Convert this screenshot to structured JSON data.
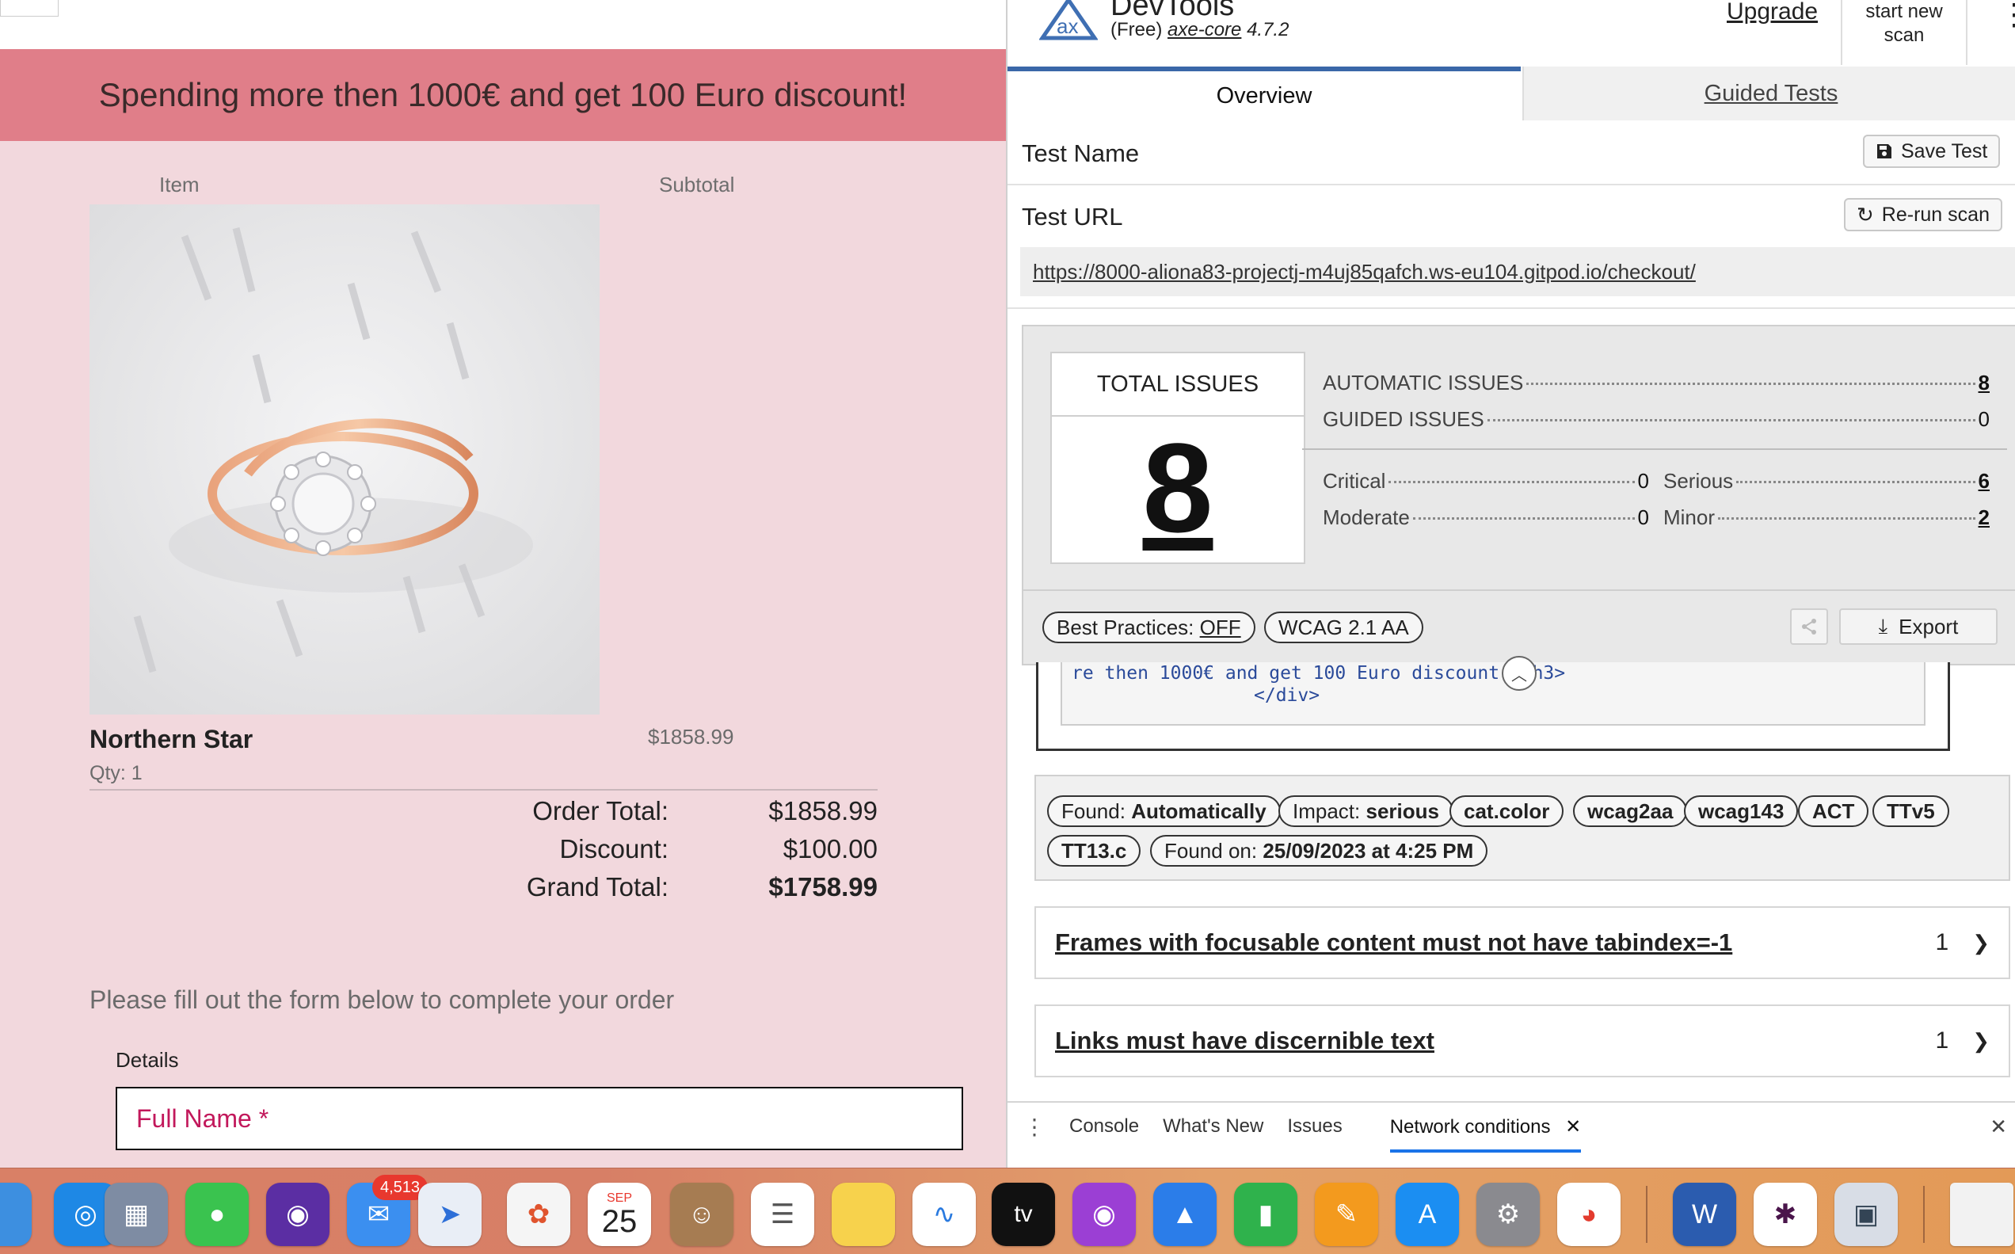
{
  "page": {
    "banner": "Spending more then 1000€ and get 100 Euro discount!",
    "columns": {
      "item": "Item",
      "subtotal": "Subtotal"
    },
    "product": {
      "name": "Northern Star",
      "price": "$1858.99",
      "qty": "Qty: 1"
    },
    "totals": [
      {
        "label": "Order Total:",
        "value": "$1858.99"
      },
      {
        "label": "Discount:",
        "value": "$100.00"
      },
      {
        "label": "Grand Total:",
        "value": "$1758.99"
      }
    ],
    "form_intro": "Please fill out the form below to complete your order",
    "details_label": "Details",
    "fullname_placeholder": "Full Name *"
  },
  "devtools": {
    "title": "DevTools",
    "edition": "(Free)",
    "engine": "axe-core",
    "version": "4.7.2",
    "upgrade": "Upgrade",
    "start_scan": [
      "start new",
      "scan"
    ],
    "tabs": {
      "overview": "Overview",
      "guided": "Guided Tests"
    },
    "test_name_label": "Test Name",
    "save_test": "Save Test",
    "test_url_label": "Test URL",
    "rerun": "Re-run scan",
    "url": "https://8000-aliona83-projectj-m4uj85qafch.ws-eu104.gitpod.io/checkout/",
    "summary": {
      "total_label": "TOTAL ISSUES",
      "total": "8",
      "automatic_label": "AUTOMATIC ISSUES",
      "automatic": "8",
      "guided_label": "GUIDED ISSUES",
      "guided": "0",
      "critical_label": "Critical",
      "critical": "0",
      "serious_label": "Serious",
      "serious": "6",
      "moderate_label": "Moderate",
      "moderate": "0",
      "minor_label": "Minor",
      "minor": "2"
    },
    "best_practices_label": "Best Practices:",
    "best_practices_value": "OFF",
    "standard": "WCAG 2.1 AA",
    "export": "Export",
    "code_line1": "re then 1000€ and  get 100 Euro discount!</h3>",
    "code_line2": "</div>",
    "found_label": "Found:",
    "found_value": "Automatically",
    "impact_label": "Impact:",
    "impact_value": "serious",
    "tags": [
      "cat.color",
      "wcag2aa",
      "wcag143",
      "ACT",
      "TTv5",
      "TT13.c"
    ],
    "found_on_label": "Found on:",
    "found_on_value": "25/09/2023 at 4:25 PM",
    "rules": [
      {
        "title": "Frames with focusable content must not have tabindex=-1",
        "count": "1"
      },
      {
        "title": "Links must have discernible text",
        "count": "1"
      }
    ],
    "drawer_tabs": [
      "Console",
      "What's New",
      "Issues",
      "Network conditions"
    ]
  },
  "dock": {
    "mail_badge": "4,513",
    "calendar_month": "SEP",
    "calendar_day": "25",
    "tv_label": "tv"
  },
  "colors": {
    "banner": "#e07e89",
    "page_bg": "#f2d8dd",
    "tab_accent": "#3a67a8",
    "required_text": "#c2185b"
  }
}
